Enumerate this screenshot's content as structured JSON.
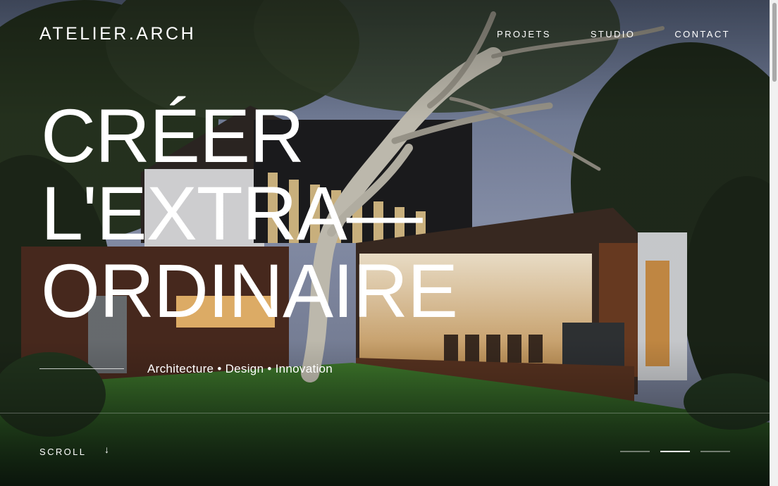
{
  "brand": {
    "logo": "ATELIER.ARCH"
  },
  "nav": {
    "items": [
      "PROJETS",
      "STUDIO",
      "CONTACT"
    ]
  },
  "hero": {
    "headline": [
      "CRÉER",
      "L'EXTRA—",
      "ORDINAIRE"
    ],
    "tagline": "Architecture • Design • Innovation"
  },
  "footer": {
    "scroll_label": "SCROLL",
    "scroll_icon": "arrow-down-icon",
    "pager": {
      "count": 3,
      "active_index": 1
    }
  }
}
